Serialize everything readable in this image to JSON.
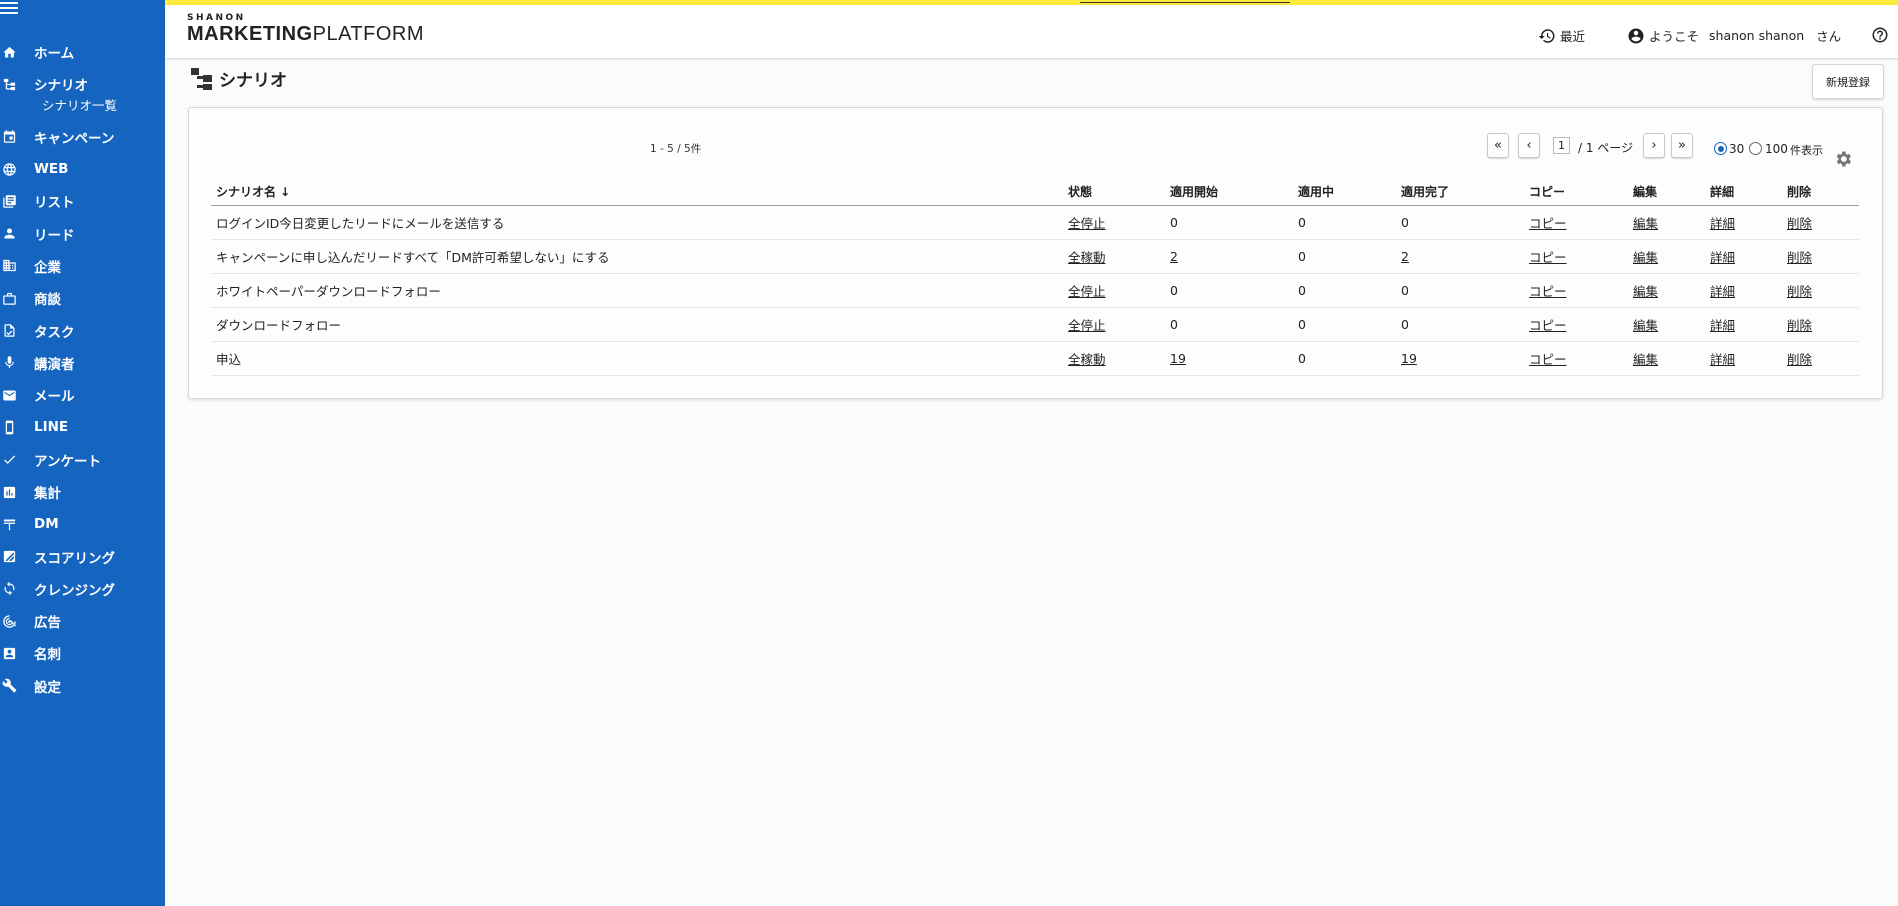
{
  "sidebar": {
    "items": [
      {
        "label": "ホーム",
        "icon": "home-icon"
      },
      {
        "label": "シナリオ",
        "icon": "scenario-icon"
      },
      {
        "label": "キャンペーン",
        "icon": "calendar-icon"
      },
      {
        "label": "WEB",
        "icon": "globe-icon"
      },
      {
        "label": "リスト",
        "icon": "list-icon"
      },
      {
        "label": "リード",
        "icon": "person-icon"
      },
      {
        "label": "企業",
        "icon": "building-icon"
      },
      {
        "label": "商談",
        "icon": "briefcase-icon"
      },
      {
        "label": "タスク",
        "icon": "task-icon"
      },
      {
        "label": "講演者",
        "icon": "mic-icon"
      },
      {
        "label": "メール",
        "icon": "mail-icon"
      },
      {
        "label": "LINE",
        "icon": "phone-icon"
      },
      {
        "label": "アンケート",
        "icon": "check-icon"
      },
      {
        "label": "集計",
        "icon": "chart-icon"
      },
      {
        "label": "DM",
        "icon": "dm-icon"
      },
      {
        "label": "スコアリング",
        "icon": "scoring-icon"
      },
      {
        "label": "クレンジング",
        "icon": "cleansing-icon"
      },
      {
        "label": "広告",
        "icon": "ad-icon"
      },
      {
        "label": "名刺",
        "icon": "card-icon"
      },
      {
        "label": "設定",
        "icon": "wrench-icon"
      }
    ],
    "sub_item": "シナリオ一覧"
  },
  "header": {
    "logo_small": "SHANON",
    "logo_big_1": "MARKETING",
    "logo_big_2": "PLATFORM",
    "recent": "最近",
    "welcome": "ようこそ",
    "user": "shanon shanon",
    "san": "さん"
  },
  "page": {
    "title": "シナリオ",
    "new_button": "新規登録",
    "count": "1 - 5 / 5件",
    "page_first": "«",
    "page_prev": "‹",
    "page_next": "›",
    "page_last": "»",
    "page_current": "1",
    "page_total": "/ 1 ページ",
    "per_page_30": "30",
    "per_page_100": "100",
    "per_page_suffix": "件表示"
  },
  "table": {
    "headers": [
      "シナリオ名 ↓",
      "状態",
      "適用開始",
      "適用中",
      "適用完了",
      "コピー",
      "編集",
      "詳細",
      "削除"
    ],
    "rows": [
      {
        "name": "ログインID今日変更したリードにメールを送信する",
        "status": "全停止",
        "start": "0",
        "active": "0",
        "done": "0",
        "copy": "コピー",
        "edit": "編集",
        "detail": "詳細",
        "delete": "削除"
      },
      {
        "name": "キャンペーンに申し込んだリードすべて「DM許可希望しない」にする",
        "status": "全稼動",
        "start": "2",
        "active": "0",
        "done": "2",
        "copy": "コピー",
        "edit": "編集",
        "detail": "詳細",
        "delete": "削除"
      },
      {
        "name": "ホワイトペーパーダウンロードフォロー",
        "status": "全停止",
        "start": "0",
        "active": "0",
        "done": "0",
        "copy": "コピー",
        "edit": "編集",
        "detail": "詳細",
        "delete": "削除"
      },
      {
        "name": "ダウンロードフォロー",
        "status": "全停止",
        "start": "0",
        "active": "0",
        "done": "0",
        "copy": "コピー",
        "edit": "編集",
        "detail": "詳細",
        "delete": "削除"
      },
      {
        "name": "申込",
        "status": "全稼動",
        "start": "19",
        "active": "0",
        "done": "19",
        "copy": "コピー",
        "edit": "編集",
        "detail": "詳細",
        "delete": "削除"
      }
    ]
  },
  "colors": {
    "sidebar": "#1565c0",
    "stripe": "#fdea3c"
  }
}
